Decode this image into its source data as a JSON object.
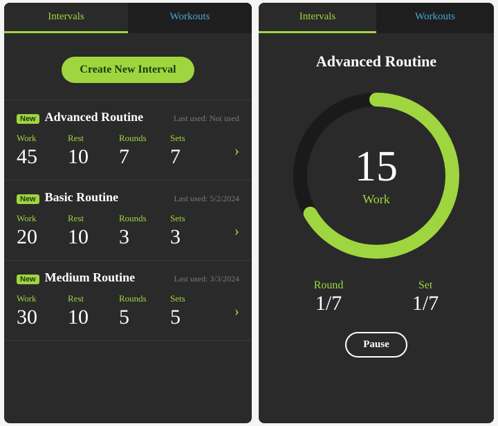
{
  "left": {
    "tabs": {
      "intervals": "Intervals",
      "workouts": "Workouts"
    },
    "create_label": "Create New Interval",
    "last_used_prefix": "Last used: ",
    "new_badge": "New",
    "stat_labels": {
      "work": "Work",
      "rest": "Rest",
      "rounds": "Rounds",
      "sets": "Sets"
    },
    "cards": [
      {
        "title": "Advanced Routine",
        "last_used": "Not used",
        "work": "45",
        "rest": "10",
        "rounds": "7",
        "sets": "7"
      },
      {
        "title": "Basic Routine",
        "last_used": "5/2/2024",
        "work": "20",
        "rest": "10",
        "rounds": "3",
        "sets": "3"
      },
      {
        "title": "Medium Routine",
        "last_used": "3/3/2024",
        "work": "30",
        "rest": "10",
        "rounds": "5",
        "sets": "5"
      }
    ]
  },
  "right": {
    "tabs": {
      "intervals": "Intervals",
      "workouts": "Workouts"
    },
    "title": "Advanced Routine",
    "timer_value": "15",
    "phase": "Work",
    "round": {
      "label": "Round",
      "value": "1/7"
    },
    "set": {
      "label": "Set",
      "value": "1/7"
    },
    "pause_label": "Pause",
    "ring_progress_deg": 240,
    "colors": {
      "accent": "#9fd63f",
      "track": "#1a1a1a"
    }
  }
}
